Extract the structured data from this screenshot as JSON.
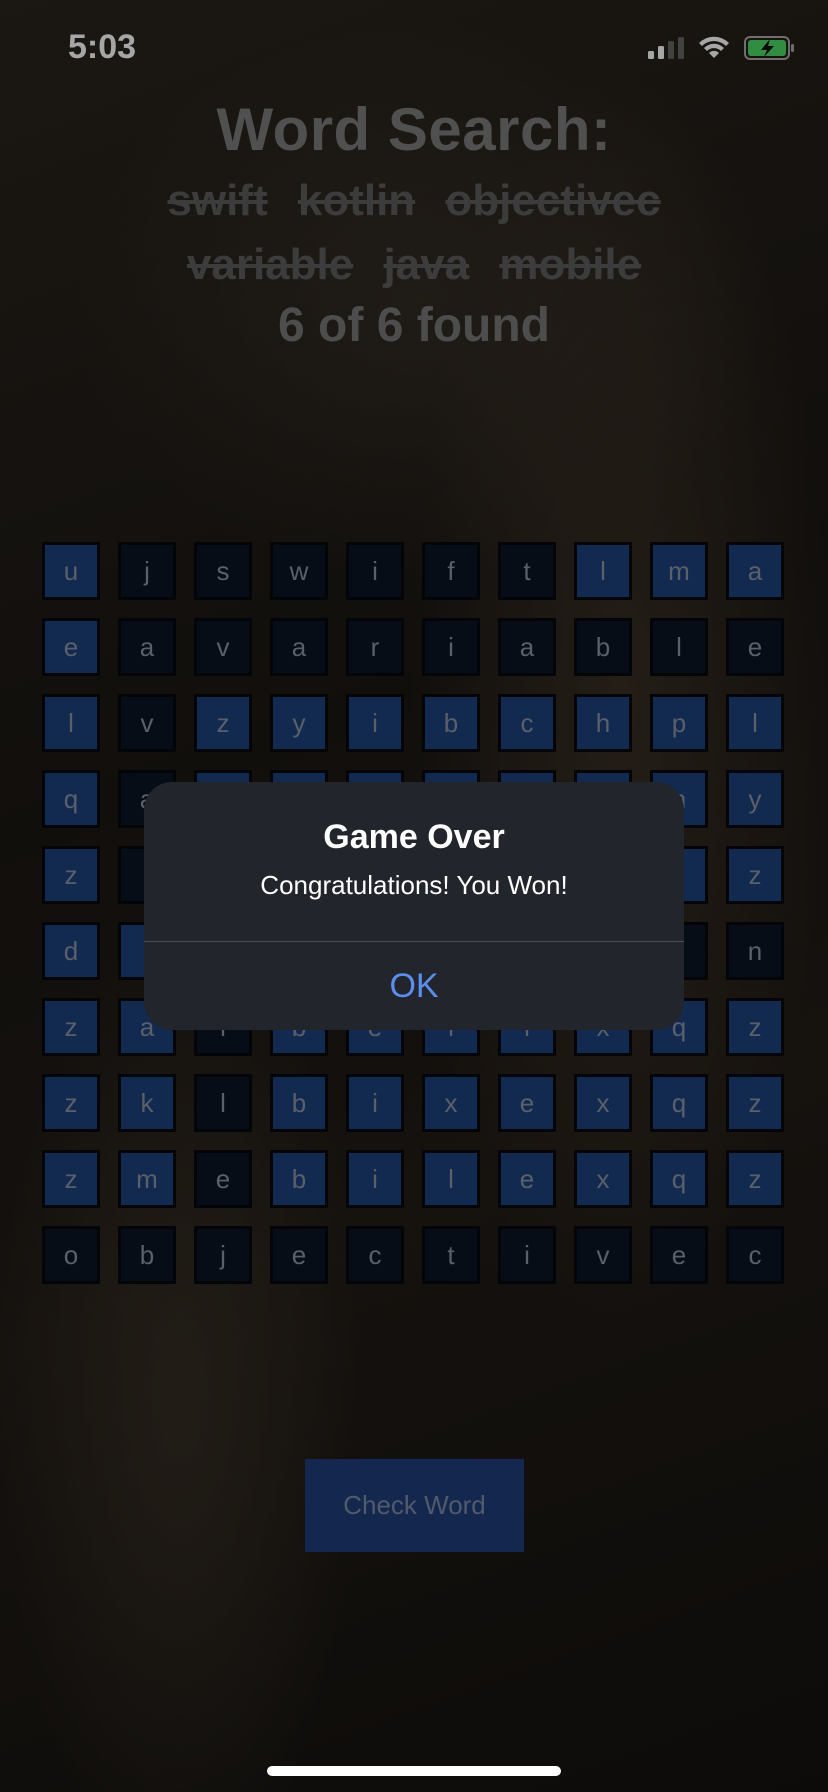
{
  "status_bar": {
    "time": "5:03"
  },
  "header": {
    "title": "Word Search:",
    "words_row1": [
      "swift",
      "kotlin",
      "objectivec"
    ],
    "words_row2": [
      "variable",
      "java",
      "mobile"
    ],
    "found_text": "6 of 6 found"
  },
  "grid": {
    "rows": [
      [
        [
          "u",
          1
        ],
        [
          "j",
          0
        ],
        [
          "s",
          0
        ],
        [
          "w",
          0
        ],
        [
          "i",
          0
        ],
        [
          "f",
          0
        ],
        [
          "t",
          0
        ],
        [
          "l",
          1
        ],
        [
          "m",
          1
        ],
        [
          "a",
          1
        ]
      ],
      [
        [
          "e",
          1
        ],
        [
          "a",
          0
        ],
        [
          "v",
          0
        ],
        [
          "a",
          0
        ],
        [
          "r",
          0
        ],
        [
          "i",
          0
        ],
        [
          "a",
          0
        ],
        [
          "b",
          0
        ],
        [
          "l",
          0
        ],
        [
          "e",
          0
        ]
      ],
      [
        [
          "l",
          1
        ],
        [
          "v",
          0
        ],
        [
          "z",
          1
        ],
        [
          "y",
          1
        ],
        [
          "i",
          1
        ],
        [
          "b",
          1
        ],
        [
          "c",
          1
        ],
        [
          "h",
          1
        ],
        [
          "p",
          1
        ],
        [
          "l",
          1
        ]
      ],
      [
        [
          "q",
          1
        ],
        [
          "a",
          0
        ],
        [
          "",
          1
        ],
        [
          "",
          1
        ],
        [
          "",
          1
        ],
        [
          "",
          1
        ],
        [
          "",
          1
        ],
        [
          "",
          1
        ],
        [
          "n",
          1
        ],
        [
          "y",
          1
        ]
      ],
      [
        [
          "z",
          1
        ],
        [
          "r",
          0
        ],
        [
          "",
          1
        ],
        [
          "",
          1
        ],
        [
          "",
          1
        ],
        [
          "",
          1
        ],
        [
          "",
          1
        ],
        [
          "",
          1
        ],
        [
          "l",
          1
        ],
        [
          "z",
          1
        ]
      ],
      [
        [
          "d",
          1
        ],
        [
          "",
          1
        ],
        [
          "",
          1
        ],
        [
          "",
          1
        ],
        [
          "",
          1
        ],
        [
          "",
          1
        ],
        [
          "",
          1
        ],
        [
          "",
          1
        ],
        [
          "",
          0
        ],
        [
          "n",
          0
        ]
      ],
      [
        [
          "z",
          1
        ],
        [
          "a",
          1
        ],
        [
          "i",
          0
        ],
        [
          "b",
          1
        ],
        [
          "e",
          1
        ],
        [
          "i",
          1
        ],
        [
          "i",
          1
        ],
        [
          "x",
          1
        ],
        [
          "q",
          1
        ],
        [
          "z",
          1
        ]
      ],
      [
        [
          "z",
          1
        ],
        [
          "k",
          1
        ],
        [
          "l",
          0
        ],
        [
          "b",
          1
        ],
        [
          "i",
          1
        ],
        [
          "x",
          1
        ],
        [
          "e",
          1
        ],
        [
          "x",
          1
        ],
        [
          "q",
          1
        ],
        [
          "z",
          1
        ]
      ],
      [
        [
          "z",
          1
        ],
        [
          "m",
          1
        ],
        [
          "e",
          0
        ],
        [
          "b",
          1
        ],
        [
          "i",
          1
        ],
        [
          "l",
          1
        ],
        [
          "e",
          1
        ],
        [
          "x",
          1
        ],
        [
          "q",
          1
        ],
        [
          "z",
          1
        ]
      ],
      [
        [
          "o",
          0
        ],
        [
          "b",
          0
        ],
        [
          "j",
          0
        ],
        [
          "e",
          0
        ],
        [
          "c",
          0
        ],
        [
          "t",
          0
        ],
        [
          "i",
          0
        ],
        [
          "v",
          0
        ],
        [
          "e",
          0
        ],
        [
          "c",
          0
        ]
      ]
    ]
  },
  "check_button": {
    "label": "Check Word"
  },
  "alert": {
    "title": "Game Over",
    "message": "Congratulations! You Won!",
    "ok_label": "OK"
  },
  "colors": {
    "cell_selected": "#1d3f7c",
    "cell_unselected": "#0b1423",
    "accent": "#5b8ef0"
  }
}
